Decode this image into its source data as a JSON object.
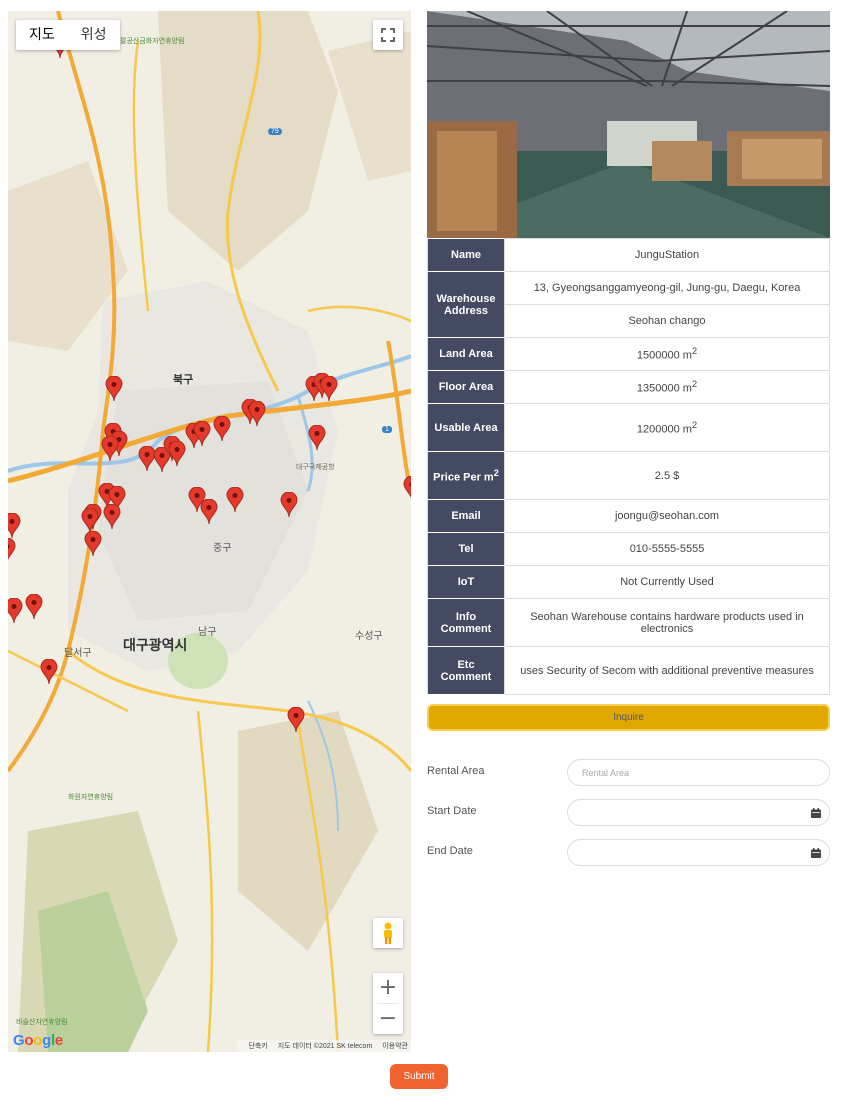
{
  "map": {
    "type_map": "지도",
    "type_satellite": "위성",
    "labels": {
      "city": "대구광역시",
      "bukgu": "북구",
      "junggu": "중구",
      "namgu": "남구",
      "dalseogu": "달서구",
      "suseonggu": "수성구",
      "airport": "대구국제공항",
      "forest1": "팔공산금화자연휴양림",
      "forest2": "화원자연휴양림",
      "forest3": "비슬산자연휴양림",
      "route79": "79",
      "route1": "1"
    },
    "google": "Google",
    "attribution": {
      "shortcuts": "단축키",
      "data": "지도 데이터 ©2021 SK telecom",
      "terms": "이용약관"
    },
    "zoom_in": "+",
    "zoom_out": "−"
  },
  "warehouse": {
    "rows": [
      {
        "label": "Name",
        "value": "JunguStation"
      },
      {
        "label": "Warehouse Address",
        "value": "13, Gyeongsanggamyeong-gil, Jung-gu, Daegu, Korea",
        "value2": "Seohan chango"
      },
      {
        "label": "Land Area",
        "value": "1500000 m",
        "sup": "2"
      },
      {
        "label": "Floor Area",
        "value": "1350000 m",
        "sup": "2"
      },
      {
        "label": "Usable Area",
        "value": "1200000 m",
        "sup": "2"
      },
      {
        "label": "Price Per m",
        "label_sup": "2",
        "value": "2.5 $"
      },
      {
        "label": "Email",
        "value": "joongu@seohan.com"
      },
      {
        "label": "Tel",
        "value": "010-5555-5555"
      },
      {
        "label": "IoT",
        "value": "Not Currently Used"
      },
      {
        "label": "Info Comment",
        "value": "Seohan Warehouse contains hardware products used in electronics"
      },
      {
        "label": "Etc Comment",
        "value": "uses Security of Secom with additional preventive measures"
      }
    ]
  },
  "inquire_label": "Inquire",
  "form": {
    "rental_area_label": "Rental Area",
    "rental_area_placeholder": "Rental Area",
    "start_date_label": "Start Date",
    "end_date_label": "End Date"
  },
  "submit_label": "Submit",
  "colors": {
    "header": "#454a63",
    "inquire": "#e0a800",
    "submit": "#f0632f",
    "pin": "#e5392b"
  }
}
